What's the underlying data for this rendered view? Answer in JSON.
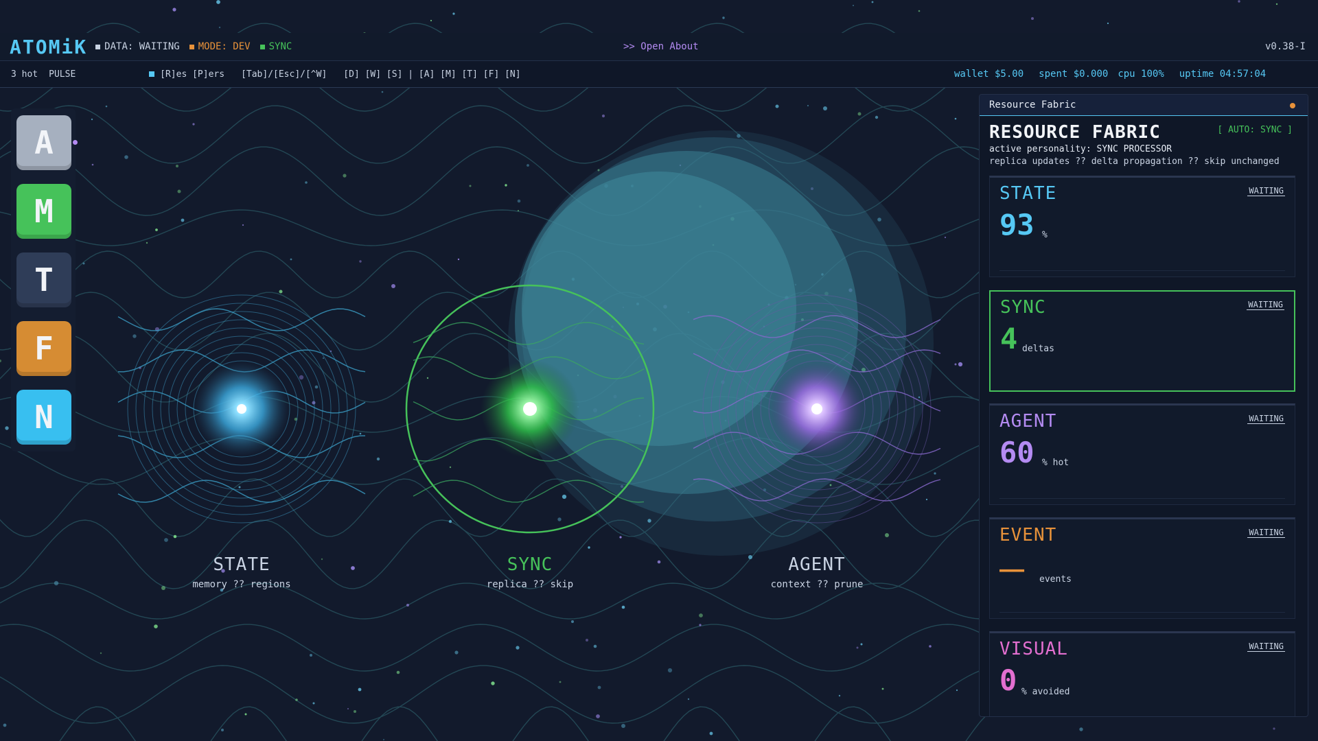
{
  "topbar": {
    "logo": "ATOMiK",
    "status": [
      {
        "label": "DATA: WAITING",
        "color": "#c9d3e3"
      },
      {
        "label": "MODE: DEV",
        "color": "#e8923a"
      },
      {
        "label": "SYNC",
        "color": "#46c25a"
      }
    ],
    "open_about": ">> Open About",
    "version": "v0.38-I"
  },
  "bar2": {
    "hot": "3 hot",
    "pulse": "PULSE",
    "keys1": "[R]es [P]ers",
    "keys2": "[Tab]/[Esc]/[^W]",
    "keys3": "[D] [W] [S] | [A] [M] [T] [F] [N]",
    "wallet": "wallet $5.00",
    "spent": "spent $0.000",
    "cpu": "cpu 100%",
    "uptime": "uptime 04:57:04"
  },
  "sidebar": [
    {
      "letter": "A",
      "color": "#a6b0bf"
    },
    {
      "letter": "M",
      "color": "#46c25a"
    },
    {
      "letter": "T",
      "color": "#2f3d58"
    },
    {
      "letter": "F",
      "color": "#d68c33"
    },
    {
      "letter": "N",
      "color": "#38bff0"
    }
  ],
  "nodes": {
    "state": {
      "name": "STATE",
      "sub": "memory ?? regions",
      "color": "#c9d3e3"
    },
    "sync": {
      "name": "SYNC",
      "sub": "replica ?? skip",
      "color": "#46c25a"
    },
    "agent": {
      "name": "AGENT",
      "sub": "context ?? prune",
      "color": "#c9d3e3"
    }
  },
  "panel": {
    "header": "Resource Fabric",
    "title": "RESOURCE FABRIC",
    "auto_sync": "[ AUTO: SYNC ]",
    "personality": "active personality: SYNC PROCESSOR",
    "replica": "replica updates ?? delta propagation ?? skip unchanged",
    "cards": [
      {
        "title": "STATE",
        "badge": "WAITING",
        "value": "93",
        "unit": "%",
        "color": "#56c8f4"
      },
      {
        "title": "SYNC",
        "badge": "WAITING",
        "value": "4",
        "unit": "deltas",
        "color": "#46c25a"
      },
      {
        "title": "AGENT",
        "badge": "WAITING",
        "value": "60",
        "unit": "% hot",
        "color": "#b48bf2"
      },
      {
        "title": "EVENT",
        "badge": "WAITING",
        "value": "——",
        "unit": "events",
        "color": "#e8923a"
      },
      {
        "title": "VISUAL",
        "badge": "WAITING",
        "value": "0",
        "unit": "% avoided",
        "color": "#e36fd0"
      }
    ]
  }
}
